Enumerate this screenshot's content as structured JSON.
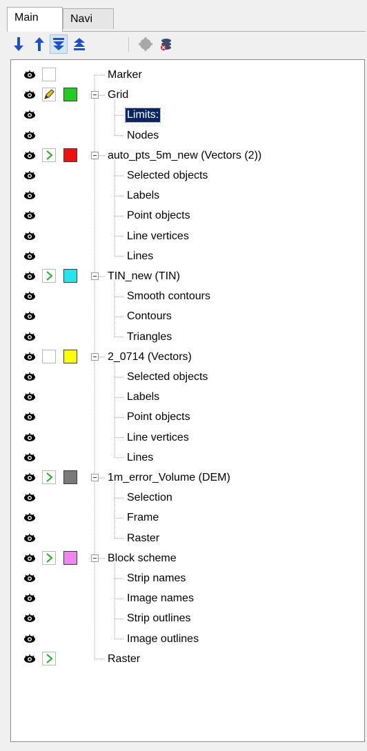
{
  "tabs": [
    "Main",
    "Navi"
  ],
  "toolbar": {
    "buttons": [
      {
        "name": "move-down-arrow-icon",
        "color": "#1a4fd0"
      },
      {
        "name": "move-up-arrow-icon",
        "color": "#1a4fd0"
      },
      {
        "name": "move-to-bottom-icon",
        "color": "#1a4fd0"
      },
      {
        "name": "move-to-top-icon",
        "color": "#1a4fd0"
      },
      {
        "name": "layer-gear-icon",
        "color": "#9a9a9a"
      },
      {
        "name": "delete-layer-icon",
        "color": "#3a4a6a"
      }
    ]
  },
  "tree": {
    "rows": [
      {
        "level": 0,
        "label": "Marker",
        "state": "empty",
        "color": null,
        "expand": false
      },
      {
        "level": 0,
        "label": "Grid",
        "state": "edit",
        "color": "#22cc22",
        "expand": true
      },
      {
        "level": 1,
        "label": "Limits:",
        "selected": true
      },
      {
        "level": 1,
        "label": "Nodes"
      },
      {
        "level": 0,
        "label": "auto_pts_5m_new (Vectors (2))",
        "state": "active",
        "color": "#ee1111",
        "expand": true
      },
      {
        "level": 1,
        "label": "Selected objects"
      },
      {
        "level": 1,
        "label": "Labels"
      },
      {
        "level": 1,
        "label": "Point objects"
      },
      {
        "level": 1,
        "label": "Line vertices"
      },
      {
        "level": 1,
        "label": "Lines"
      },
      {
        "level": 0,
        "label": "TIN_new (TIN)",
        "state": "active",
        "color": "#22e6ee",
        "expand": true
      },
      {
        "level": 1,
        "label": "Smooth contours"
      },
      {
        "level": 1,
        "label": "Contours"
      },
      {
        "level": 1,
        "label": "Triangles"
      },
      {
        "level": 0,
        "label": "2_0714 (Vectors)",
        "state": "empty",
        "color": "#ffff00",
        "expand": true
      },
      {
        "level": 1,
        "label": "Selected objects"
      },
      {
        "level": 1,
        "label": "Labels"
      },
      {
        "level": 1,
        "label": "Point objects"
      },
      {
        "level": 1,
        "label": "Line vertices"
      },
      {
        "level": 1,
        "label": "Lines"
      },
      {
        "level": 0,
        "label": "1m_error_Volume (DEM)",
        "state": "active",
        "color": "#7a7a7a",
        "expand": true
      },
      {
        "level": 1,
        "label": "Selection"
      },
      {
        "level": 1,
        "label": "Frame"
      },
      {
        "level": 1,
        "label": "Raster"
      },
      {
        "level": 0,
        "label": "Block scheme",
        "state": "active",
        "color": "#ee88ee",
        "expand": true
      },
      {
        "level": 1,
        "label": "Strip names"
      },
      {
        "level": 1,
        "label": "Image names"
      },
      {
        "level": 1,
        "label": "Strip outlines"
      },
      {
        "level": 1,
        "label": "Image outlines"
      },
      {
        "level": 0,
        "label": "Raster",
        "state": "active",
        "color": null,
        "expand": false
      }
    ]
  }
}
